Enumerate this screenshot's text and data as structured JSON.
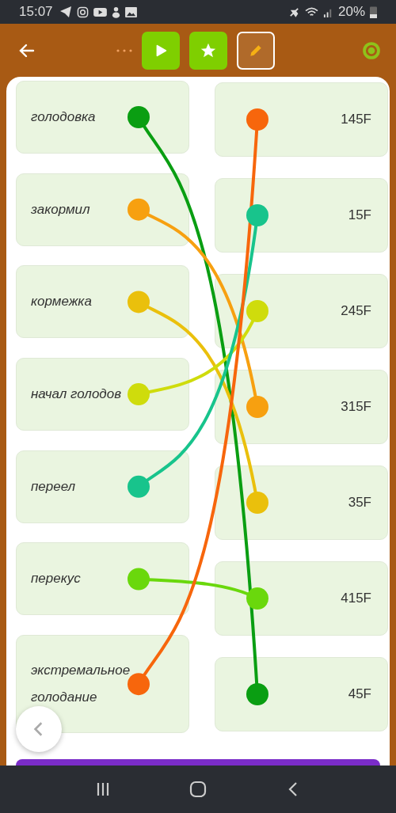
{
  "status_bar": {
    "time": "15:07",
    "battery": "20%"
  },
  "left": [
    {
      "text": "голодовка",
      "color": "#0a9e12"
    },
    {
      "text": "закормил",
      "color": "#f7a010"
    },
    {
      "text": "кормежка",
      "color": "#eac00c"
    },
    {
      "text": "начал голодов",
      "color": "#cfdc0c"
    },
    {
      "text": "переел",
      "color": "#18c48c"
    },
    {
      "text": "перекус",
      "color": "#6ad80c"
    },
    {
      "text": "экстремальное голодание",
      "color": "#f7660c"
    }
  ],
  "right": [
    {
      "text": "145F",
      "color": "#f7660c"
    },
    {
      "text": "15F",
      "color": "#18c48c"
    },
    {
      "text": "245F",
      "color": "#cfdc0c"
    },
    {
      "text": "315F",
      "color": "#f7a010"
    },
    {
      "text": "35F",
      "color": "#eac00c"
    },
    {
      "text": "415F",
      "color": "#6ad80c"
    },
    {
      "text": "45F",
      "color": "#0a9e12"
    }
  ]
}
